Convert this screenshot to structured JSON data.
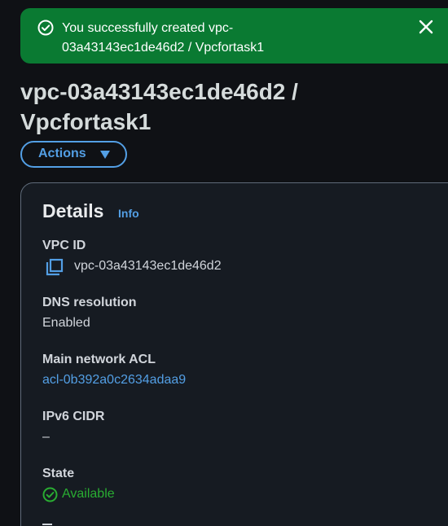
{
  "flash": {
    "line1": "You successfully created vpc-",
    "line2": "03a43143ec1de46d2 / Vpcfortask1",
    "status_icon": "check-circle-icon",
    "close_icon": "close-icon",
    "color": "#0a7a32"
  },
  "header": {
    "title_line1": "vpc-03a43143ec1de46d2 /",
    "title_line2": "Vpcfortask1",
    "actions_label": "Actions"
  },
  "details": {
    "heading": "Details",
    "info_link": "Info",
    "fields": {
      "vpc_id": {
        "label": "VPC ID",
        "value": "vpc-03a43143ec1de46d2"
      },
      "dns_resolution": {
        "label": "DNS resolution",
        "value": "Enabled"
      },
      "main_network_acl": {
        "label": "Main network ACL",
        "value": "acl-0b392a0c2634adaa9"
      },
      "ipv6_cidr": {
        "label": "IPv6 CIDR",
        "value": "–"
      },
      "state": {
        "label": "State",
        "value": "Available"
      }
    }
  },
  "colors": {
    "background": "#0f1115",
    "panel": "#161b22",
    "accent_link": "#539fe5",
    "success": "#29ad32",
    "text": "#d1d5db"
  }
}
